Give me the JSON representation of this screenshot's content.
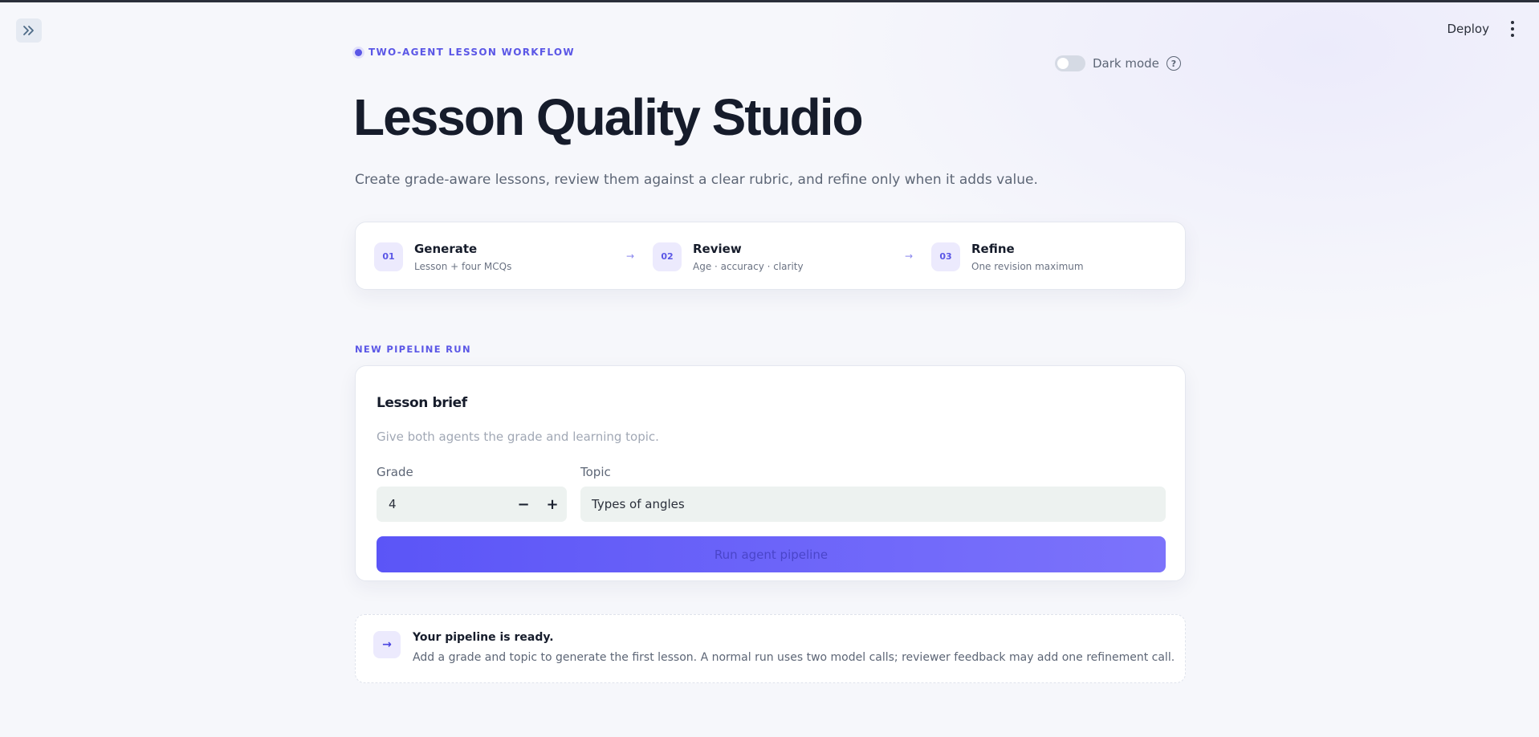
{
  "header": {
    "deploy_label": "Deploy"
  },
  "hero": {
    "eyebrow": "TWO-AGENT LESSON WORKFLOW",
    "title": "Lesson Quality Studio",
    "subtitle": "Create grade-aware lessons, review them against a clear rubric, and refine only when it adds value.",
    "dark_mode_label": "Dark mode",
    "dark_mode_on": false,
    "help_glyph": "?"
  },
  "steps": [
    {
      "num": "01",
      "name": "Generate",
      "desc": "Lesson + four MCQs"
    },
    {
      "num": "02",
      "name": "Review",
      "desc": "Age · accuracy · clarity"
    },
    {
      "num": "03",
      "name": "Refine",
      "desc": "One revision maximum"
    }
  ],
  "section_label": "NEW PIPELINE RUN",
  "brief": {
    "title": "Lesson brief",
    "subtitle": "Give both agents the grade and learning topic.",
    "grade_label": "Grade",
    "grade_value": "4",
    "minus_glyph": "−",
    "plus_glyph": "+",
    "topic_label": "Topic",
    "topic_value": "Types of angles",
    "run_label": "Run agent pipeline"
  },
  "ready": {
    "icon_glyph": "→",
    "title": "Your pipeline is ready.",
    "text": "Add a grade and topic to generate the first lesson. A normal run uses two model calls; reviewer feedback may add one refinement call."
  },
  "colors": {
    "accent": "#5b57e6",
    "button_start": "#5b55f7",
    "button_end": "#7c73fb",
    "background": "#f6f7fb"
  }
}
